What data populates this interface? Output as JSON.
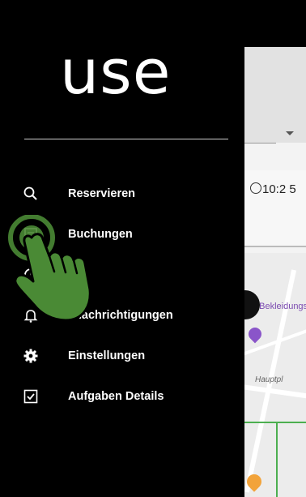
{
  "drawer": {
    "logo_text": "use",
    "items": [
      {
        "label": "Reservieren",
        "icon": "search-icon"
      },
      {
        "label": "Buchungen",
        "icon": "list-icon"
      },
      {
        "label": "",
        "icon": "history-icon"
      },
      {
        "label": "enachrichtigungen",
        "icon": "bell-icon"
      },
      {
        "label": "Einstellungen",
        "icon": "gear-icon"
      },
      {
        "label": "Aufgaben Details",
        "icon": "checkbox-icon"
      }
    ]
  },
  "background": {
    "time_text": "10:2 5",
    "shop_label": "&A Bekleidungsge",
    "street_label": "Hauptpl"
  },
  "colors": {
    "drawer_bg": "#000000",
    "text": "#ffffff",
    "hint_green": "#4a8a35",
    "map_pin": "#8a55c9"
  }
}
